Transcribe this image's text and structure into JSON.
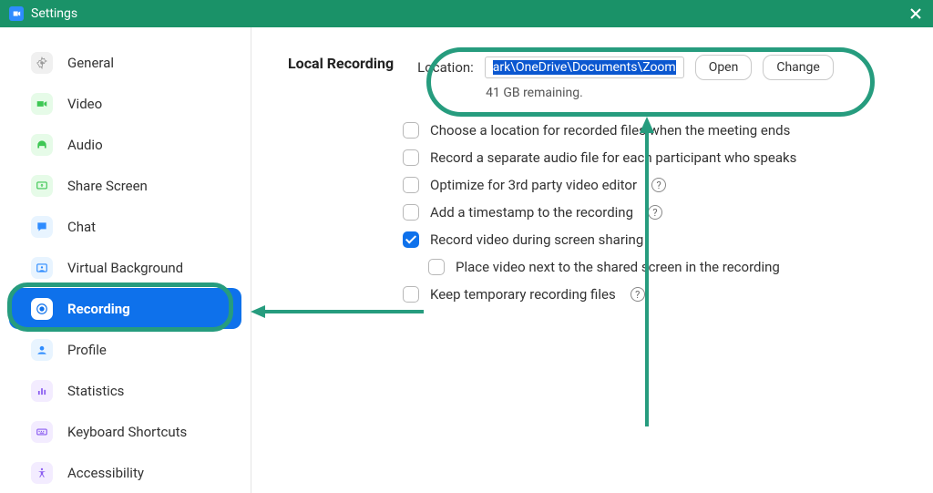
{
  "titlebar": {
    "title": "Settings"
  },
  "sidebar": {
    "items": [
      {
        "label": "General"
      },
      {
        "label": "Video"
      },
      {
        "label": "Audio"
      },
      {
        "label": "Share Screen"
      },
      {
        "label": "Chat"
      },
      {
        "label": "Virtual Background"
      },
      {
        "label": "Recording"
      },
      {
        "label": "Profile"
      },
      {
        "label": "Statistics"
      },
      {
        "label": "Keyboard Shortcuts"
      },
      {
        "label": "Accessibility"
      }
    ],
    "active_index": 6
  },
  "recording": {
    "section_title": "Local Recording",
    "location_label": "Location:",
    "location_value": "ark\\OneDrive\\Documents\\Zoom",
    "open_btn": "Open",
    "change_btn": "Change",
    "remaining": "41 GB remaining.",
    "options": [
      {
        "label": "Choose a location for recorded files when the meeting ends",
        "checked": false,
        "help": false,
        "indent": false
      },
      {
        "label": "Record a separate audio file for each participant who speaks",
        "checked": false,
        "help": false,
        "indent": false
      },
      {
        "label": "Optimize for 3rd party video editor",
        "checked": false,
        "help": true,
        "indent": false
      },
      {
        "label": "Add a timestamp to the recording",
        "checked": false,
        "help": true,
        "indent": false
      },
      {
        "label": "Record video during screen sharing",
        "checked": true,
        "help": false,
        "indent": false
      },
      {
        "label": "Place video next to the shared screen in the recording",
        "checked": false,
        "help": false,
        "indent": true
      },
      {
        "label": "Keep temporary recording files",
        "checked": false,
        "help": true,
        "indent": false
      }
    ]
  },
  "annotations": {
    "arrow_color": "#269c7e"
  }
}
